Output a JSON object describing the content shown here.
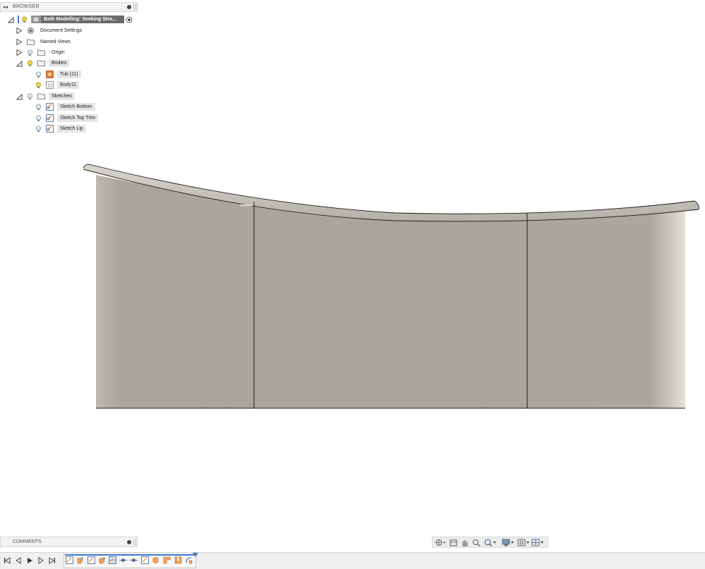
{
  "browser": {
    "title": "BROWSER",
    "collapse_icon": "double-left-arrow",
    "root": {
      "label": "Bath Modelling: Seeking Stra..."
    },
    "items": [
      {
        "label": "Document Settings",
        "icon": "gear-icon",
        "expanded": false
      },
      {
        "label": "Named Views",
        "icon": "folder-icon",
        "expanded": false
      },
      {
        "label": "Origin",
        "icon": "folder-icon",
        "expanded": false
      },
      {
        "label": "Bodies",
        "icon": "folder-icon",
        "expanded": true
      },
      {
        "label": "Tub (11)",
        "icon": "body-orange-icon"
      },
      {
        "label": "Body11",
        "icon": "body-icon"
      },
      {
        "label": "Sketches",
        "icon": "folder-icon",
        "expanded": true
      },
      {
        "label": "Sketch Bottom",
        "icon": "sketch-icon"
      },
      {
        "label": "Sketch Top Trim",
        "icon": "sketch-icon"
      },
      {
        "label": "Sketch Lip",
        "icon": "sketch-icon"
      }
    ]
  },
  "comments": {
    "title": "COMMENTS"
  },
  "colors": {
    "model_face": "#a9a69d",
    "model_highlight": "#d3d0c7",
    "edge": "#1a1a1a",
    "selection_blue": "#3a7bd5",
    "bulb_yellow": "#e2c227",
    "sketch_orange": "#e07a2e"
  },
  "nav_toolbar": {
    "buttons": [
      "orbit-icon",
      "look-at-icon",
      "pan-icon",
      "zoom-icon",
      "zoom-window-icon",
      "display-settings-icon",
      "grid-icon",
      "viewports-icon"
    ]
  },
  "timeline": {
    "controls": [
      "go-to-start-icon",
      "step-back-icon",
      "play-icon",
      "step-forward-icon",
      "go-to-end-icon"
    ],
    "features": [
      "sketch",
      "extrude",
      "sketch",
      "extrude",
      "sketch",
      "loft",
      "joint",
      "joint",
      "sketch",
      "revolve",
      "fillet",
      "shell",
      "sweep"
    ]
  }
}
